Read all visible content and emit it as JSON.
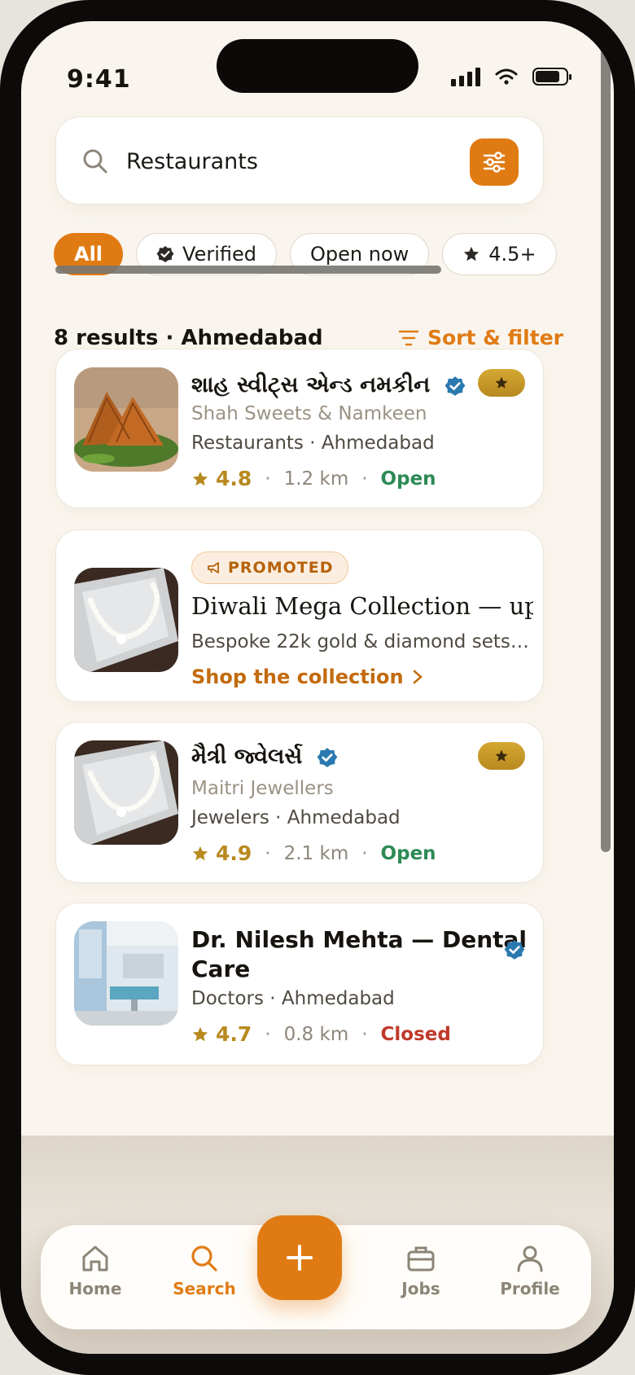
{
  "status_bar": {
    "time": "9:41"
  },
  "search": {
    "value": "Restaurants",
    "placeholder": ""
  },
  "chips": [
    {
      "label": "All",
      "active": true
    },
    {
      "label": "Verified",
      "icon": "verified-badge-icon"
    },
    {
      "label": "Open now"
    },
    {
      "label": "4.5+",
      "icon": "star-icon"
    }
  ],
  "results": {
    "summary": "8 results · Ahmedabad",
    "sort_label": "Sort & filter"
  },
  "cards": [
    {
      "title": "શાહ સ્વીટ્સ એન્ડ નમકીન",
      "subtitle": "Shah Sweets & Namkeen",
      "category": "Restaurants · Ahmedabad",
      "rating": "4.8",
      "distance": "1.2 km",
      "status": "Open"
    },
    {
      "title": "મૈત્રી જ્વેલર્સ",
      "subtitle": "Maitri Jewellers",
      "category": "Jewelers · Ahmedabad",
      "rating": "4.9",
      "distance": "2.1 km",
      "status": "Open"
    },
    {
      "title_line1": "Dr. Nilesh Mehta — Dental",
      "title_line2": "Care",
      "category": "Doctors · Ahmedabad",
      "rating": "4.7",
      "distance": "0.8 km",
      "status": "Closed"
    }
  ],
  "promo": {
    "badge": "PROMOTED",
    "title": "Diwali Mega Collection — up",
    "description": "Bespoke 22k gold & diamond sets · …",
    "cta": "Shop the collection"
  },
  "separators": {
    "dot": "·"
  },
  "tabbar": {
    "home": "Home",
    "search": "Search",
    "jobs": "Jobs",
    "profile": "Profile"
  },
  "colors": {
    "accent": "#e07b14",
    "background": "#f9f5ee",
    "open": "#2d8a55",
    "closed": "#c0392b",
    "rating": "#b8891f",
    "verified": "#2a79b0"
  }
}
